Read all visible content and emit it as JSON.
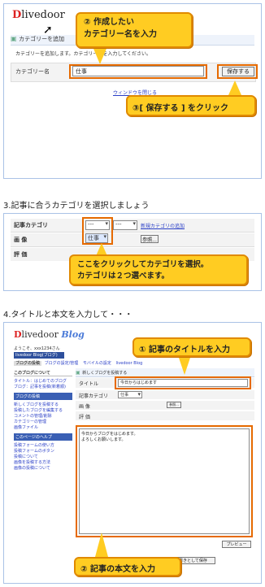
{
  "brand": {
    "logo_text": "livedoor",
    "blog_text": "Blog"
  },
  "section1": {
    "panel_header": "カテゴリーを追加",
    "instruction": "カテゴリーを追加します。カテゴリー名を入力してください。",
    "category_label": "カテゴリー名",
    "category_value": "仕事",
    "save_button": "保存する",
    "close_link": "ウィンドウを閉じる",
    "callout_enter_name_line1": "② 作成したい",
    "callout_enter_name_line2": "カテゴリー名を入力",
    "callout_click_save": "③[ 保存する ] をクリック"
  },
  "step3": {
    "heading": "3.記事に合うカテゴリを選択しましょう",
    "category_label": "記事カテゴリ",
    "select1_value": "---",
    "select2_value": "---",
    "add_category_link": "新規カテゴリの追加",
    "image_label": "画 像",
    "browse_button": "参照...",
    "rating_label": "評 価",
    "dropdown_option": "仕事",
    "callout_line1": "ここをクリックしてカテゴリを選択。",
    "callout_line2": "カテゴリは２つ選べます。"
  },
  "step4": {
    "heading": "4.タイトルと本文を入力して・・・",
    "greeting": "ようこそ、xxx1234さん",
    "blog_name": "livedoor Blog(ブログ)",
    "tabs": [
      "ブログの投稿",
      "ブログの設定/管理",
      "モバイルの設定",
      "livedoor Blog"
    ],
    "side_section_title": "このブログについて",
    "side_items": [
      "タイトル：はじめてのブログ",
      "ブログ：記事を投稿(新着順)"
    ],
    "side_menu_title": "ブログの投稿",
    "side_menu_items": [
      "新しくブログを投稿する",
      "投稿したブログを編集する",
      "コメントの管理/削除",
      "カテゴリーの管理",
      "画像ファイル"
    ],
    "side_info_title": "このページのヘルプ",
    "side_info_items": [
      "投稿フォームの使い方",
      "投稿フォームのボタン",
      "投稿について",
      "画像を投稿する方法",
      "画像の投稿について"
    ],
    "form_title": "新しくブログを投稿する",
    "title_label": "タイトル",
    "title_value": "今日からはじめます",
    "category_label": "記事カテゴリ",
    "category_value": "仕事",
    "image_label": "画 像",
    "rating_label": "評 価",
    "body_value_line1": "今日からブログをはじめます。",
    "body_value_line2": "よろしくお願いします。",
    "preview_button": "プレビュー",
    "save_button": "下書きとして保存",
    "callout_title": "① 記事のタイトルを入力",
    "callout_body": "② 記事の本文を入力"
  }
}
